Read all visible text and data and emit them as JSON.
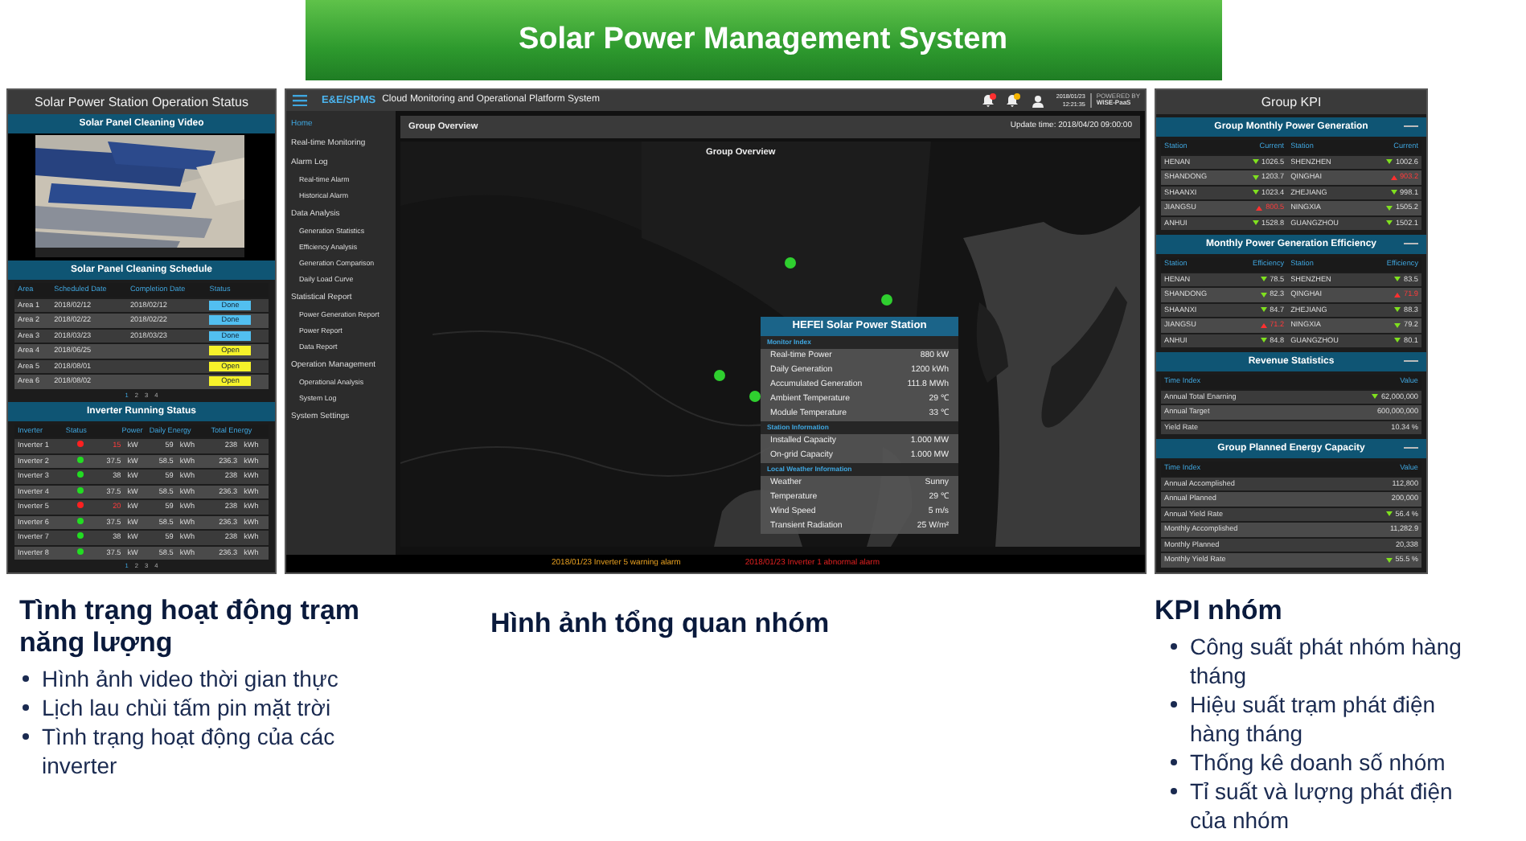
{
  "slide_title": "Solar Power Management System",
  "operation_status": {
    "title": "Solar Power Station Operation Status",
    "video": {
      "title": "Solar Panel Cleaning Video",
      "kind": "picture"
    },
    "schedule": {
      "title": "Solar Panel Cleaning Schedule",
      "columns": [
        "Area",
        "Scheduled Date",
        "Completion Date",
        "Status"
      ],
      "rows": [
        {
          "area": "Area 1",
          "scheduled": "2018/02/12",
          "completed": "2018/02/12",
          "status": "Done",
          "kind": "done"
        },
        {
          "area": "Area 2",
          "scheduled": "2018/02/22",
          "completed": "2018/02/22",
          "status": "Done",
          "kind": "done"
        },
        {
          "area": "Area 3",
          "scheduled": "2018/03/23",
          "completed": "2018/03/23",
          "status": "Done",
          "kind": "done"
        },
        {
          "area": "Area 4",
          "scheduled": "2018/06/25",
          "status": "Open",
          "kind": "open"
        },
        {
          "area": "Area 5",
          "scheduled": "2018/08/01",
          "status": "Open",
          "kind": "open"
        },
        {
          "area": "Area 6",
          "scheduled": "2018/08/02",
          "status": "Open",
          "kind": "open"
        }
      ],
      "pages": [
        {
          "label": "1",
          "selected": true
        },
        {
          "label": "2",
          "selected": false
        },
        {
          "label": "3",
          "selected": false
        },
        {
          "label": "4",
          "selected": false
        }
      ]
    },
    "inverters": {
      "title": "Inverter Running Status",
      "columns": [
        "Inverter",
        "Status",
        "Power",
        "Daily Energy",
        "Total Energy"
      ],
      "rows": [
        {
          "name": "Inverter 1",
          "alarm": true,
          "power": "15",
          "power_unit": "kW",
          "daily": "59",
          "daily_unit": "kWh",
          "total": "238",
          "total_unit": "kWh"
        },
        {
          "name": "Inverter 2",
          "alarm": false,
          "power": "37.5",
          "power_unit": "kW",
          "daily": "58.5",
          "daily_unit": "kWh",
          "total": "236.3",
          "total_unit": "kWh"
        },
        {
          "name": "Inverter 3",
          "alarm": false,
          "power": "38",
          "power_unit": "kW",
          "daily": "59",
          "daily_unit": "kWh",
          "total": "238",
          "total_unit": "kWh"
        },
        {
          "name": "Inverter 4",
          "alarm": false,
          "power": "37.5",
          "power_unit": "kW",
          "daily": "58.5",
          "daily_unit": "kWh",
          "total": "236.3",
          "total_unit": "kWh"
        },
        {
          "name": "Inverter 5",
          "alarm": true,
          "power": "20",
          "power_unit": "kW",
          "daily": "59",
          "daily_unit": "kWh",
          "total": "238",
          "total_unit": "kWh"
        },
        {
          "name": "Inverter 6",
          "alarm": false,
          "power": "37.5",
          "power_unit": "kW",
          "daily": "58.5",
          "daily_unit": "kWh",
          "total": "236.3",
          "total_unit": "kWh"
        },
        {
          "name": "Inverter 7",
          "alarm": false,
          "power": "38",
          "power_unit": "kW",
          "daily": "59",
          "daily_unit": "kWh",
          "total": "238",
          "total_unit": "kWh"
        },
        {
          "name": "Inverter 8",
          "alarm": false,
          "power": "37.5",
          "power_unit": "kW",
          "daily": "58.5",
          "daily_unit": "kWh",
          "total": "236.3",
          "total_unit": "kWh"
        }
      ],
      "pages": [
        {
          "label": "1",
          "selected": true
        },
        {
          "label": "2",
          "selected": false
        },
        {
          "label": "3",
          "selected": false
        },
        {
          "label": "4",
          "selected": false
        }
      ]
    }
  },
  "platform": {
    "logo": "E&E/SPMS",
    "title": "Cloud Monitoring and Operational Platform System",
    "notifications": [
      {
        "kind": "alarm"
      },
      {
        "kind": "warning"
      }
    ],
    "date": "2018/01/23",
    "time": "12:21:35",
    "powered_by": "POWERED BY",
    "brand": "WISE-PaaS",
    "menu": [
      {
        "label": "Home",
        "selected": true
      },
      {
        "label": "Real-time Monitoring",
        "selected": false
      },
      {
        "label": "Alarm Log",
        "selected": false,
        "children": [
          {
            "label": "Real-time Alarm",
            "selected": false
          },
          {
            "label": "Historical Alarm",
            "selected": false
          }
        ]
      },
      {
        "label": "Data Analysis",
        "selected": false,
        "children": [
          {
            "label": "Generation Statistics",
            "selected": false
          },
          {
            "label": "Efficiency Analysis",
            "selected": false
          },
          {
            "label": "Generation Comparison",
            "selected": false
          },
          {
            "label": "Daily Load Curve",
            "selected": false
          }
        ]
      },
      {
        "label": "Statistical Report",
        "selected": false,
        "children": [
          {
            "label": "Power Generation Report",
            "selected": false
          },
          {
            "label": "Power Report",
            "selected": false
          },
          {
            "label": "Data Report",
            "selected": false
          }
        ]
      },
      {
        "label": "Operation Management",
        "selected": false,
        "children": [
          {
            "label": "Operational Analysis",
            "selected": false
          },
          {
            "label": "System Log",
            "selected": false
          }
        ]
      },
      {
        "label": "System Settings",
        "selected": false
      }
    ],
    "overview": {
      "title": "Group Overview",
      "update_time": "Update time: 2018/04/20 09:00:00",
      "map_title": "Group Overview",
      "popup": {
        "title": "HEFEI Solar Power Station",
        "sections": [
          {
            "title": "Monitor Index",
            "rows": [
              {
                "label": "Real-time Power",
                "value": "880 kW"
              },
              {
                "label": "Daily Generation",
                "value": "1200 kWh"
              },
              {
                "label": "Accumulated Generation",
                "value": "111.8 MWh"
              },
              {
                "label": "Ambient Temperature",
                "value": "29 ℃"
              },
              {
                "label": "Module Temperature",
                "value": "33 ℃"
              }
            ]
          },
          {
            "title": "Station Information",
            "rows": [
              {
                "label": "Installed Capacity",
                "value": "1.000 MW"
              },
              {
                "label": "On-grid Capacity",
                "value": "1.000 MW"
              }
            ]
          },
          {
            "title": "Local Weather Information",
            "rows": [
              {
                "label": "Weather",
                "value": "Sunny"
              },
              {
                "label": "Temperature",
                "value": "29 ℃"
              },
              {
                "label": "Wind Speed",
                "value": "5 m/s"
              },
              {
                "label": "Transient Radiation",
                "value": "25 W/m²"
              }
            ]
          }
        ]
      }
    },
    "alarms": [
      {
        "text": "2018/01/23 Inverter 5 warning alarm",
        "kind": "warning"
      },
      {
        "text": "2018/01/23 Inverter 1 abnormal alarm",
        "kind": "abnormal"
      }
    ]
  },
  "kpi": {
    "title": "Group KPI",
    "monthly_generation": {
      "title": "Group Monthly Power Generation",
      "columns": [
        "Station",
        "Current",
        "Station",
        "Current"
      ],
      "rows": [
        [
          {
            "station": "HENAN",
            "kind": "down",
            "value": "1026.5"
          },
          {
            "station": "SHENZHEN",
            "kind": "down",
            "value": "1002.6"
          }
        ],
        [
          {
            "station": "SHANDONG",
            "kind": "down",
            "value": "1203.7"
          },
          {
            "station": "QINGHAI",
            "kind": "up",
            "value": "903.2"
          }
        ],
        [
          {
            "station": "SHAANXI",
            "kind": "down",
            "value": "1023.4"
          },
          {
            "station": "ZHEJIANG",
            "kind": "down",
            "value": "998.1"
          }
        ],
        [
          {
            "station": "JIANGSU",
            "kind": "up",
            "value": "800.5"
          },
          {
            "station": "NINGXIA",
            "kind": "down",
            "value": "1505.2"
          }
        ],
        [
          {
            "station": "ANHUI",
            "kind": "down",
            "value": "1528.8"
          },
          {
            "station": "GUANGZHOU",
            "kind": "down",
            "value": "1502.1"
          }
        ]
      ]
    },
    "monthly_efficiency": {
      "title": "Monthly Power Generation Efficiency",
      "columns": [
        "Station",
        "Efficiency",
        "Station",
        "Efficiency"
      ],
      "rows": [
        [
          {
            "station": "HENAN",
            "kind": "down",
            "value": "78.5"
          },
          {
            "station": "SHENZHEN",
            "kind": "down",
            "value": "83.5"
          }
        ],
        [
          {
            "station": "SHANDONG",
            "kind": "down",
            "value": "82.3"
          },
          {
            "station": "QINGHAI",
            "kind": "up",
            "value": "71.9"
          }
        ],
        [
          {
            "station": "SHAANXI",
            "kind": "down",
            "value": "84.7"
          },
          {
            "station": "ZHEJIANG",
            "kind": "down",
            "value": "88.3"
          }
        ],
        [
          {
            "station": "JIANGSU",
            "kind": "up",
            "value": "71.2"
          },
          {
            "station": "NINGXIA",
            "kind": "down",
            "value": "79.2"
          }
        ],
        [
          {
            "station": "ANHUI",
            "kind": "down",
            "value": "84.8"
          },
          {
            "station": "GUANGZHOU",
            "kind": "down",
            "value": "80.1"
          }
        ]
      ]
    },
    "revenue": {
      "title": "Revenue Statistics",
      "columns": [
        "Time Index",
        "Value"
      ],
      "rows": [
        {
          "label": "Annual Total Enarning",
          "kind": "down",
          "value": "62,000,000"
        },
        {
          "label": "Annual Target",
          "value": "600,000,000"
        },
        {
          "label": "Yield Rate",
          "value": "10.34 %"
        }
      ]
    },
    "capacity": {
      "title": "Group Planned Energy Capacity",
      "columns": [
        "Time Index",
        "Value"
      ],
      "rows": [
        {
          "label": "Annual Accomplished",
          "value": "112,800"
        },
        {
          "label": "Annual Planned",
          "value": "200,000"
        },
        {
          "label": "Annual Yield Rate",
          "kind": "down",
          "value": "56.4 %"
        },
        {
          "label": "Monthly Accomplished",
          "value": "11,282.9"
        },
        {
          "label": "Monthly Planned",
          "value": "20,338"
        },
        {
          "label": "Monthly Yield Rate",
          "kind": "down",
          "value": "55.5 %"
        }
      ]
    }
  },
  "captions": [
    {
      "heading": "Tình trạng hoạt động trạm năng lượng",
      "bullets": [
        "Hình ảnh video thời gian thực",
        "Lịch lau chùi tấm pin mặt trời",
        "Tình trạng hoạt động của các inverter"
      ]
    },
    {
      "heading": "Hình ảnh tổng quan nhóm"
    },
    {
      "heading": "KPI nhóm",
      "bullets": [
        "Công suất phát nhóm hàng tháng",
        "Hiệu suất trạm phát điện hàng tháng",
        "Thống kê doanh số nhóm",
        "Tỉ suất và lượng phát điện của nhóm"
      ]
    }
  ]
}
